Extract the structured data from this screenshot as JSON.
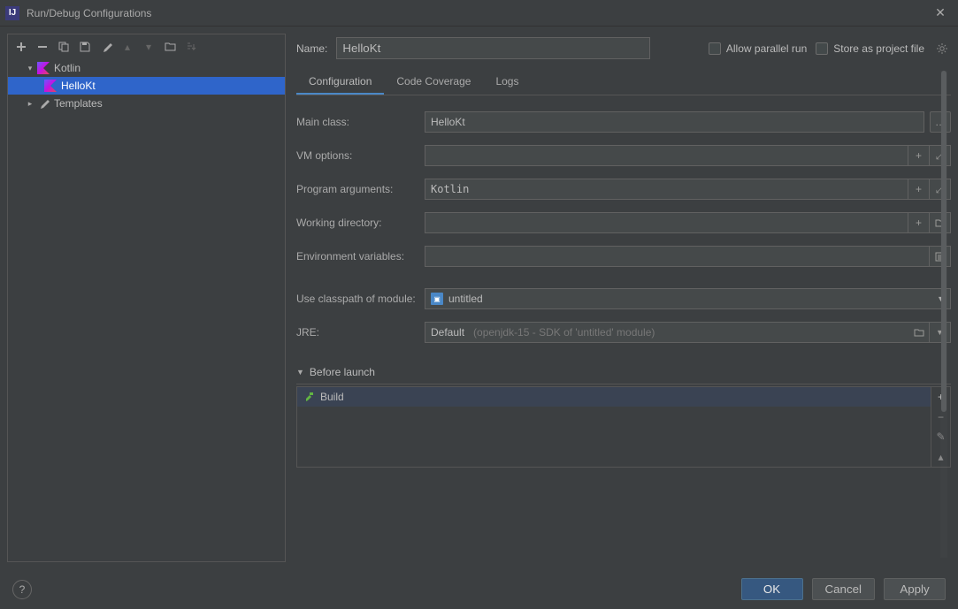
{
  "window": {
    "title": "Run/Debug Configurations"
  },
  "tree": {
    "kotlin": {
      "label": "Kotlin"
    },
    "hello": {
      "label": "HelloKt"
    },
    "templates": {
      "label": "Templates"
    }
  },
  "header": {
    "name_label": "Name:",
    "name_value": "HelloKt",
    "allow_parallel": "Allow parallel run",
    "store_project": "Store as project file"
  },
  "tabs": {
    "config": "Configuration",
    "coverage": "Code Coverage",
    "logs": "Logs"
  },
  "form": {
    "main_class": {
      "label": "Main class:",
      "value": "HelloKt"
    },
    "vm_options": {
      "label": "VM options:",
      "value": ""
    },
    "prog_args": {
      "label": "Program arguments:",
      "value": "Kotlin"
    },
    "work_dir": {
      "label": "Working directory:",
      "value": ""
    },
    "env_vars": {
      "label": "Environment variables:",
      "value": ""
    },
    "classpath": {
      "label": "Use classpath of module:",
      "value": "untitled"
    },
    "jre": {
      "label": "JRE:",
      "value": "Default",
      "hint": "(openjdk-15 - SDK of 'untitled' module)"
    }
  },
  "before": {
    "header": "Before launch",
    "build": "Build"
  },
  "buttons": {
    "ok": "OK",
    "cancel": "Cancel",
    "apply": "Apply"
  }
}
